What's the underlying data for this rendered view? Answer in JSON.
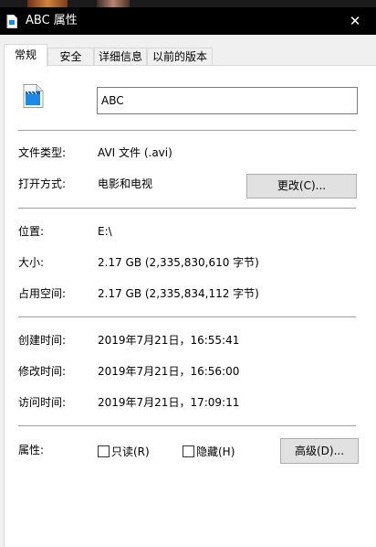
{
  "window": {
    "title": "ABC 属性",
    "close_glyph": "✕"
  },
  "tabs": [
    {
      "label": "常规"
    },
    {
      "label": "安全"
    },
    {
      "label": "详细信息"
    },
    {
      "label": "以前的版本"
    }
  ],
  "file": {
    "name": "ABC",
    "icon": "video-file-icon"
  },
  "type_section": {
    "file_type_label": "文件类型:",
    "file_type_value": "AVI 文件 (.avi)",
    "opens_with_label": "打开方式:",
    "opens_with_value": "电影和电视",
    "change_button": "更改(C)..."
  },
  "size_section": {
    "location_label": "位置:",
    "location_value": "E:\\",
    "size_label": "大小:",
    "size_value": "2.17 GB (2,335,830,610 字节)",
    "size_on_disk_label": "占用空间:",
    "size_on_disk_value": "2.17 GB (2,335,834,112 字节)"
  },
  "time_section": {
    "created_label": "创建时间:",
    "created_value": "2019年7月21日，16:55:41",
    "modified_label": "修改时间:",
    "modified_value": "2019年7月21日，16:56:00",
    "accessed_label": "访问时间:",
    "accessed_value": "2019年7月21日，17:09:11"
  },
  "attributes": {
    "label": "属性:",
    "readonly": "只读(R)",
    "hidden": "隐藏(H)",
    "advanced_button": "高级(D)..."
  },
  "colors": {
    "titlebar_bg": "#000000",
    "panel_bg": "#ffffff",
    "icon_blue": "#1e88e5"
  }
}
